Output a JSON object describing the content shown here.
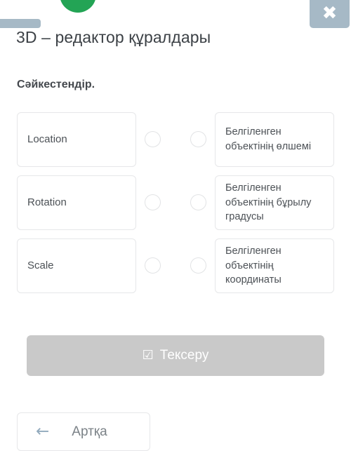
{
  "header": {
    "title": "3D – редактор құралдары",
    "close_icon": "close-icon",
    "badge_icon": "green-circle-badge",
    "tab_icon": "gray-tab-marker"
  },
  "instruction": {
    "text": "Сәйкестендір."
  },
  "match_rows": [
    {
      "left_label": "Location",
      "right_label": "Белгіленген объектінің өлшемі",
      "left_dot_selected": false,
      "right_dot_selected": false
    },
    {
      "left_label": "Rotation",
      "right_label": "Белгіленген объектінің бұрылу градусы",
      "left_dot_selected": false,
      "right_dot_selected": false
    },
    {
      "left_label": "Scale",
      "right_label": "Белгіленген объектінің координаты",
      "left_dot_selected": false,
      "right_dot_selected": false
    }
  ],
  "check_button": {
    "label": "Тексеру",
    "icon": "☑",
    "enabled": false
  },
  "back_button": {
    "label": "Артқа",
    "icon": "←"
  },
  "colors": {
    "accent_green": "#23a455",
    "close_blue_gray": "#a6b9c6",
    "check_button_gray": "#c9c9c9",
    "card_border": "#e6e7e9",
    "title_text": "#3c4146",
    "body_text": "#4c5156",
    "arrow_blue": "#92aabd"
  }
}
